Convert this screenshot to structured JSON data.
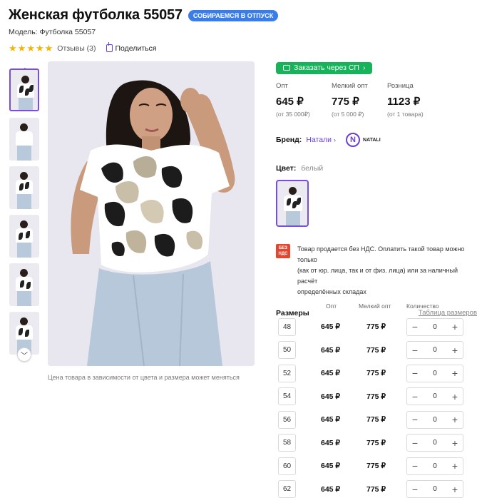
{
  "product": {
    "title": "Женская футболка 55057",
    "promo_badge": "СОБИРАЕМСЯ В ОТПУСК",
    "model": "Модель: Футболка 55057",
    "rating_stars": 5,
    "reviews": "Отзывы (3)",
    "share": "Поделиться"
  },
  "gallery": {
    "caption": "Цена товара в зависимости от цвета и размера может меняться",
    "thumbnails_count": 6,
    "active_thumbnail": 0
  },
  "order": {
    "sp_button": "Заказать через СП",
    "sp_chevron": "›"
  },
  "prices": [
    {
      "label": "Опт",
      "value": "645 ₽",
      "min": "(от 35 000₽)"
    },
    {
      "label": "Мелкий опт",
      "value": "775 ₽",
      "min": "(от 5 000 ₽)"
    },
    {
      "label": "Розница",
      "value": "1123 ₽",
      "min": "(от 1 товара)"
    }
  ],
  "brand": {
    "label": "Бренд:",
    "name": "Натали",
    "chevron": "›",
    "logo_letter": "N",
    "logo_text": "NATALI"
  },
  "color": {
    "label": "Цвет:",
    "value": "белый"
  },
  "vat": {
    "badge": "БЕЗ НДС",
    "text": "Товар продается без НДС. Оплатить такой товар можно только\n(как от юр. лица, так и от физ. лица) или за наличный расчёт\nопределённых складах"
  },
  "sizes": {
    "title": "Размеры",
    "table_link": "Таблица размеров",
    "columns": {
      "opt": "Опт",
      "small": "Мелкий опт",
      "qty": "Количество"
    },
    "rows": [
      {
        "size": "48",
        "opt": "645 ₽",
        "small": "775 ₽",
        "qty": "0"
      },
      {
        "size": "50",
        "opt": "645 ₽",
        "small": "775 ₽",
        "qty": "0"
      },
      {
        "size": "52",
        "opt": "645 ₽",
        "small": "775 ₽",
        "qty": "0"
      },
      {
        "size": "54",
        "opt": "645 ₽",
        "small": "775 ₽",
        "qty": "0"
      },
      {
        "size": "56",
        "opt": "645 ₽",
        "small": "775 ₽",
        "qty": "0"
      },
      {
        "size": "58",
        "opt": "645 ₽",
        "small": "775 ₽",
        "qty": "0"
      },
      {
        "size": "60",
        "opt": "645 ₽",
        "small": "775 ₽",
        "qty": "0"
      },
      {
        "size": "62",
        "opt": "645 ₽",
        "small": "775 ₽",
        "qty": "0"
      }
    ],
    "minus": "−",
    "plus": "+"
  },
  "colors": {
    "accent": "#7a4fd8",
    "promo": "#3b7de8",
    "sp_green": "#16b35a",
    "star": "#f4b400",
    "vat_red": "#e2462e"
  }
}
